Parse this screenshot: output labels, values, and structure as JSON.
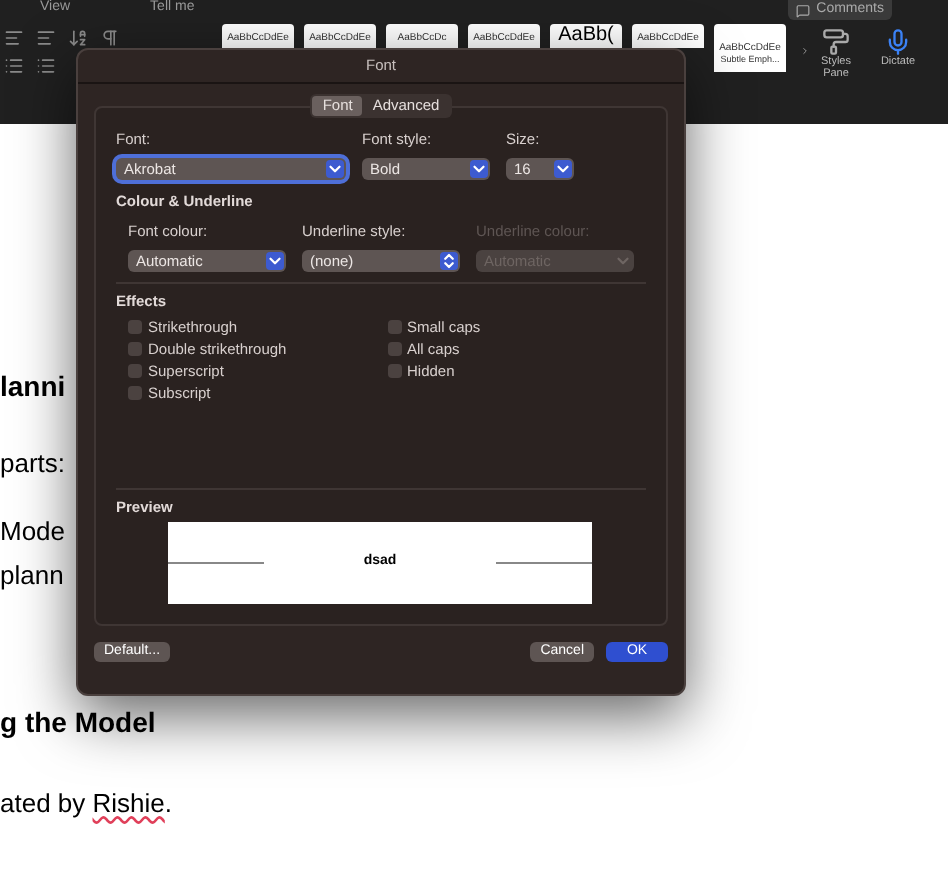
{
  "toolbar": {
    "menu": [
      "View",
      "Tell me"
    ],
    "comments_button": "Comments",
    "style_gallery": [
      {
        "preview": "AaBbCcDdEe",
        "large": false
      },
      {
        "preview": "AaBbCcDdEe",
        "large": false
      },
      {
        "preview": "AaBbCcDc",
        "large": false
      },
      {
        "preview": "AaBbCcDdEe",
        "large": false
      },
      {
        "preview": "AaBb(",
        "large": true
      },
      {
        "preview": "AaBbCcDdEe",
        "large": false
      },
      {
        "preview": "AaBbCcDdEe",
        "caption": "Subtle Emph...",
        "large": false
      }
    ],
    "styles_pane": "Styles Pane",
    "dictate": "Dictate"
  },
  "document": {
    "lines": [
      {
        "kind": "heading",
        "parts": [
          {
            "text": "lanni",
            "misspelled": false
          }
        ]
      },
      {
        "kind": "body",
        "parts": [
          {
            "text": "parts:",
            "misspelled": false
          }
        ]
      },
      {
        "kind": "body",
        "parts": [
          {
            "text": "Mode",
            "misspelled": false
          }
        ]
      },
      {
        "kind": "body",
        "parts": [
          {
            "text": "plann",
            "misspelled": false
          }
        ]
      },
      {
        "kind": "heading",
        "parts": [
          {
            "text": "g the Model",
            "misspelled": false
          }
        ]
      },
      {
        "kind": "body",
        "parts": [
          {
            "text": "ated by ",
            "misspelled": false
          },
          {
            "text": "Rishie",
            "misspelled": true
          },
          {
            "text": ".",
            "misspelled": false
          }
        ]
      }
    ]
  },
  "dialog": {
    "title": "Font",
    "tabs": [
      {
        "label": "Font",
        "selected": true
      },
      {
        "label": "Advanced",
        "selected": false
      }
    ],
    "font_fields": [
      {
        "label": "Font:",
        "value": "Akrobat",
        "focused": true
      },
      {
        "label": "Font style:",
        "value": "Bold",
        "focused": false
      },
      {
        "label": "Size:",
        "value": "16",
        "focused": false
      }
    ],
    "colour_heading": "Colour & Underline",
    "colour_fields": [
      {
        "label": "Font colour:",
        "value": "Automatic",
        "kind": "dropdown",
        "disabled": false
      },
      {
        "label": "Underline style:",
        "value": "(none)",
        "kind": "popup",
        "disabled": false
      },
      {
        "label": "Underline colour:",
        "value": "Automatic",
        "kind": "dropdown",
        "disabled": true
      }
    ],
    "effects_heading": "Effects",
    "effects_columns": [
      [
        {
          "label": "Strikethrough",
          "checked": false
        },
        {
          "label": "Double strikethrough",
          "checked": false
        },
        {
          "label": "Superscript",
          "checked": false
        },
        {
          "label": "Subscript",
          "checked": false
        }
      ],
      [
        {
          "label": "Small caps",
          "checked": false
        },
        {
          "label": "All caps",
          "checked": false
        },
        {
          "label": "Hidden",
          "checked": false
        }
      ]
    ],
    "preview_heading": "Preview",
    "preview_text": "dsad",
    "buttons": [
      {
        "label": "Default...",
        "primary": false
      },
      {
        "label": "Cancel",
        "primary": false
      },
      {
        "label": "OK",
        "primary": true
      }
    ]
  }
}
